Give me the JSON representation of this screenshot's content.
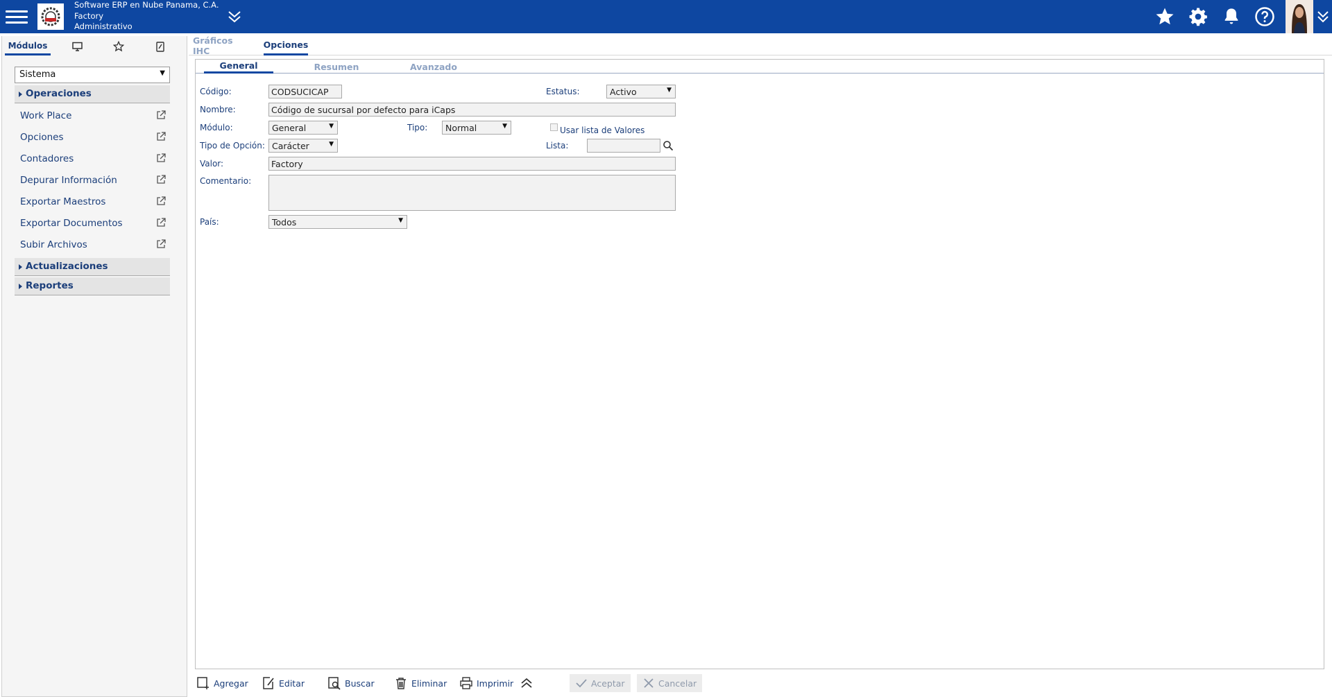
{
  "header": {
    "company_name": "Software ERP en Nube Panama, C.A.",
    "branch": "Factory",
    "role": "Administrativo",
    "brand_color": "#0e47a1"
  },
  "sidebar": {
    "tabs": [
      {
        "label": "Módulos",
        "active": true
      },
      {
        "icon": "monitor-icon"
      },
      {
        "icon": "star-icon"
      },
      {
        "icon": "bookmark-icon"
      }
    ],
    "module_select": {
      "value": "Sistema"
    },
    "groups": [
      {
        "label": "Operaciones",
        "expanded": true,
        "items": [
          {
            "label": "Work Place"
          },
          {
            "label": "Opciones"
          },
          {
            "label": "Contadores"
          },
          {
            "label": "Depurar Información"
          },
          {
            "label": "Exportar Maestros"
          },
          {
            "label": "Exportar Documentos"
          },
          {
            "label": "Subir Archivos"
          }
        ]
      },
      {
        "label": "Actualizaciones",
        "expanded": false
      },
      {
        "label": "Reportes",
        "expanded": false
      }
    ]
  },
  "main": {
    "tabs": [
      {
        "label": "Gráficos IHC",
        "active": false
      },
      {
        "label": "Opciones",
        "active": true
      }
    ],
    "sub_tabs": [
      {
        "label": "General",
        "active": true
      },
      {
        "label": "Resumen",
        "active": false
      },
      {
        "label": "Avanzado",
        "active": false
      }
    ]
  },
  "form": {
    "codigo": {
      "label": "Código:",
      "value": "CODSUCICAP"
    },
    "estatus": {
      "label": "Estatus:",
      "value": "Activo"
    },
    "nombre": {
      "label": "Nombre:",
      "value": "Código de sucursal por defecto para iCaps"
    },
    "modulo": {
      "label": "Módulo:",
      "value": "General"
    },
    "tipo": {
      "label": "Tipo:",
      "value": "Normal"
    },
    "usar_lista": {
      "label": "Usar lista de Valores",
      "checked": false
    },
    "tipo_opcion": {
      "label": "Tipo de Opción:",
      "value": "Carácter"
    },
    "lista": {
      "label": "Lista:",
      "value": ""
    },
    "valor": {
      "label": "Valor:",
      "value": "Factory"
    },
    "comentario": {
      "label": "Comentario:",
      "value": ""
    },
    "pais": {
      "label": "País:",
      "value": "Todos"
    }
  },
  "toolbar": {
    "agregar": "Agregar",
    "editar": "Editar",
    "buscar": "Buscar",
    "eliminar": "Eliminar",
    "imprimir": "Imprimir",
    "aceptar": "Aceptar",
    "cancelar": "Cancelar"
  }
}
